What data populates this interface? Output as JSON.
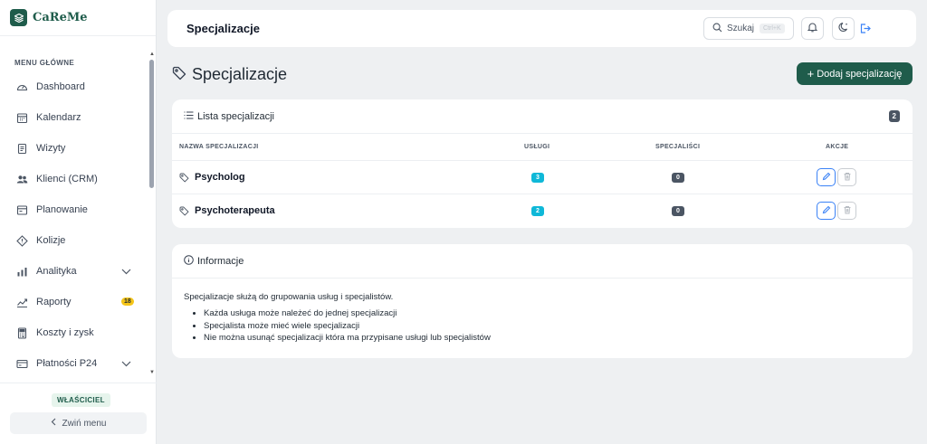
{
  "brand": {
    "name": "CaReMe"
  },
  "sidebar": {
    "heading": "MENU GŁÓWNE",
    "items": [
      {
        "label": "Dashboard",
        "icon": "gauge-icon"
      },
      {
        "label": "Kalendarz",
        "icon": "calendar-icon"
      },
      {
        "label": "Wizyty",
        "icon": "clipboard-icon"
      },
      {
        "label": "Klienci (CRM)",
        "icon": "users-icon"
      },
      {
        "label": "Planowanie",
        "icon": "schedule-icon"
      },
      {
        "label": "Kolizje",
        "icon": "warning-diamond-icon"
      },
      {
        "label": "Analityka",
        "icon": "bar-chart-icon",
        "expandable": true
      },
      {
        "label": "Raporty",
        "icon": "trend-icon",
        "badge": "18"
      },
      {
        "label": "Koszty i zysk",
        "icon": "calculator-icon"
      },
      {
        "label": "Płatności P24",
        "icon": "credit-card-icon",
        "expandable": true
      }
    ],
    "role": "WŁAŚCICIEL",
    "collapse_label": "Zwiń menu"
  },
  "header": {
    "title": "Specjalizacje",
    "search_label": "Szukaj",
    "search_shortcut": "Ctrl+K"
  },
  "page": {
    "title": "Specjalizacje",
    "add_button": "Dodaj specjalizację"
  },
  "list": {
    "title": "Lista specjalizacji",
    "count": "2",
    "columns": {
      "name": "NAZWA SPECJALIZACJI",
      "services": "USŁUGI",
      "specialists": "SPECJALIŚCI",
      "actions": "AKCJE"
    },
    "rows": [
      {
        "name": "Psycholog",
        "services": "3",
        "specialists": "0"
      },
      {
        "name": "Psychoterapeuta",
        "services": "2",
        "specialists": "0"
      }
    ]
  },
  "info": {
    "title": "Informacje",
    "intro": "Specjalizacje służą do grupowania usług i specjalistów.",
    "bullets": [
      "Każda usługa może należeć do jednej specjalizacji",
      "Specjalista może mieć wiele specjalizacji",
      "Nie można usunąć specjalizacji która ma przypisane usługi lub specjalistów"
    ]
  },
  "colors": {
    "brand": "#1f5c4b",
    "accent_cyan": "#0fb8d8",
    "badge_gray": "#4b5563",
    "badge_yellow": "#f5c518",
    "edit_blue": "#3b82f6"
  }
}
